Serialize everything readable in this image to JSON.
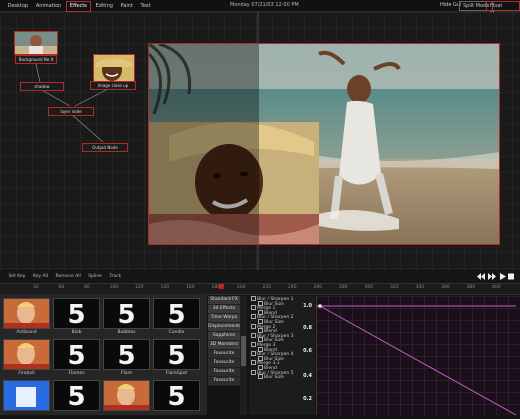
{
  "menu": {
    "items": [
      "Desktop",
      "Animation",
      "Effects",
      "Editing",
      "Paint",
      "Text"
    ],
    "active": "Effects",
    "clock": "Monday 07/21/03  12:00 PM",
    "hide_gui": "Hide Gui",
    "split_mode": "Split Mode",
    "float_menus": "Float Menus"
  },
  "nodes": {
    "background": "Background Ne.lt",
    "shadow": "shadow",
    "image_close_up": "Image close up",
    "layer_node": "layer node",
    "output_node": "Output Node"
  },
  "timeline": {
    "set_key": "Set Key",
    "key_all": "Key All",
    "remove_all": "Remove All",
    "spline": "Spline",
    "track": "Track",
    "transport_icons": [
      "rewind-icon",
      "fast-forward-icon",
      "play-icon",
      "stop-icon"
    ],
    "ruler_ticks": [
      "30",
      "60",
      "80",
      "100",
      "120",
      "140",
      "160",
      "180",
      "200",
      "220",
      "240",
      "260",
      "280",
      "300",
      "320",
      "340",
      "360",
      "380",
      "400"
    ]
  },
  "effects": [
    {
      "label": "Antiband",
      "icon": "portrait"
    },
    {
      "label": "Blob",
      "icon": "five"
    },
    {
      "label": "Bubbles",
      "icon": "five"
    },
    {
      "label": "Candle",
      "icon": "five"
    },
    {
      "label": "Fireball",
      "icon": "portrait"
    },
    {
      "label": "Flames",
      "icon": "five"
    },
    {
      "label": "Flare",
      "icon": "five"
    },
    {
      "label": "FlareSpot",
      "icon": "five"
    },
    {
      "label": "",
      "icon": "blue"
    },
    {
      "label": "",
      "icon": "five"
    },
    {
      "label": "",
      "icon": "portrait"
    },
    {
      "label": "",
      "icon": "five"
    }
  ],
  "categories": [
    "Standard FX",
    "3d Effects",
    "Time Warps",
    "Displacements",
    "Sapphires",
    "3D Monsters",
    "Favourite",
    "Favourite",
    "Favourite",
    "Favourite"
  ],
  "params": [
    {
      "text": "Blur / Sharpen 1",
      "indent": 0
    },
    {
      "text": "Blur Size",
      "indent": 1
    },
    {
      "text": "Merge 1",
      "indent": 0
    },
    {
      "text": "Blend",
      "indent": 1
    },
    {
      "text": "Blur / Sharpen 2",
      "indent": 0
    },
    {
      "text": "Blur Size",
      "indent": 1
    },
    {
      "text": "Merge 2",
      "indent": 0
    },
    {
      "text": "Blend",
      "indent": 1
    },
    {
      "text": "Blur / Sharpen 3",
      "indent": 0
    },
    {
      "text": "Blur Size",
      "indent": 1
    },
    {
      "text": "Merge 3",
      "indent": 0
    },
    {
      "text": "Blend",
      "indent": 1
    },
    {
      "text": "Blur / Sharpen 4",
      "indent": 0
    },
    {
      "text": "Blur Size",
      "indent": 1
    },
    {
      "text": "Merge 3.1",
      "indent": 0
    },
    {
      "text": "Blend",
      "indent": 1
    },
    {
      "text": "Blur / Sharpen 5",
      "indent": 0
    },
    {
      "text": "Blur Size",
      "indent": 1
    }
  ],
  "yaxis": [
    "1.0",
    "0.8",
    "0.6",
    "0.4",
    "0.2"
  ],
  "colors": {
    "accent": "#b02a2a",
    "curve": "#c060c0"
  }
}
